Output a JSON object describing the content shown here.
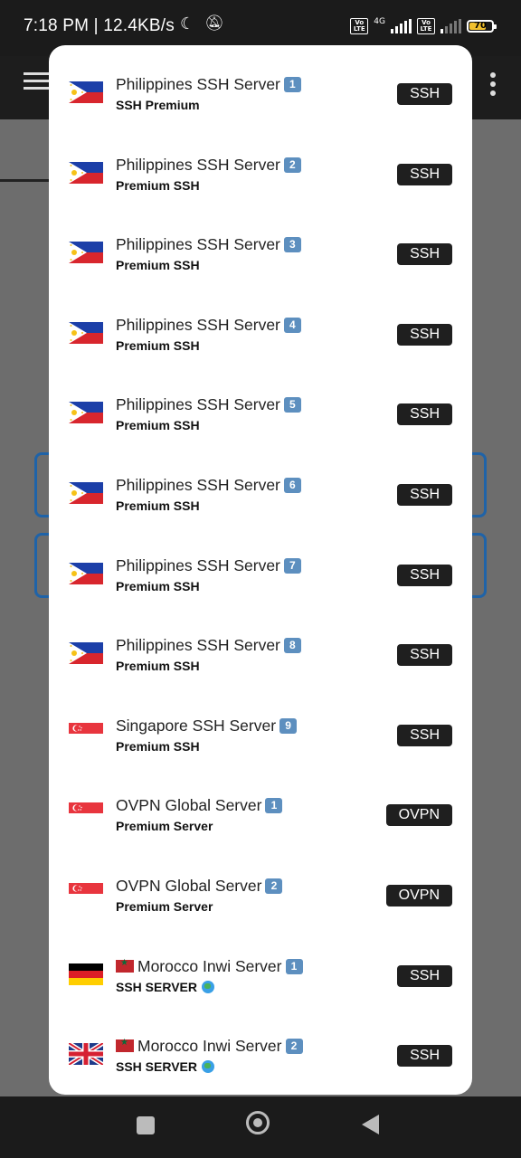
{
  "status_bar": {
    "time_speed": "7:18 PM | 12.4KB/s",
    "network": "4G",
    "volte": "Vo LTE",
    "battery": "70"
  },
  "servers": [
    {
      "title": "Philippines SSH Server",
      "number": "1",
      "subtitle": "SSH Premium",
      "badge": "SSH",
      "flag": "philippines-flag-icon"
    },
    {
      "title": "Philippines SSH Server",
      "number": "2",
      "subtitle": "Premium SSH",
      "badge": "SSH",
      "flag": "philippines-flag-icon"
    },
    {
      "title": "Philippines SSH Server",
      "number": "3",
      "subtitle": "Premium SSH",
      "badge": "SSH",
      "flag": "philippines-flag-icon"
    },
    {
      "title": "Philippines SSH Server",
      "number": "4",
      "subtitle": "Premium SSH",
      "badge": "SSH",
      "flag": "philippines-flag-icon"
    },
    {
      "title": "Philippines SSH Server",
      "number": "5",
      "subtitle": "Premium SSH",
      "badge": "SSH",
      "flag": "philippines-flag-icon"
    },
    {
      "title": "Philippines SSH Server",
      "number": "6",
      "subtitle": "Premium SSH",
      "badge": "SSH",
      "flag": "philippines-flag-icon"
    },
    {
      "title": "Philippines SSH Server",
      "number": "7",
      "subtitle": "Premium SSH",
      "badge": "SSH",
      "flag": "philippines-flag-icon"
    },
    {
      "title": "Philippines SSH Server",
      "number": "8",
      "subtitle": "Premium SSH",
      "badge": "SSH",
      "flag": "philippines-flag-icon"
    },
    {
      "title": "Singapore SSH Server",
      "number": "9",
      "subtitle": "Premium SSH",
      "badge": "SSH",
      "flag": "singapore-flag-icon"
    },
    {
      "title": "OVPN Global Server",
      "number": "1",
      "subtitle": "Premium Server",
      "badge": "OVPN",
      "flag": "singapore-flag-icon"
    },
    {
      "title": "OVPN Global Server",
      "number": "2",
      "subtitle": "Premium Server",
      "badge": "OVPN",
      "flag": "singapore-flag-icon"
    },
    {
      "title": "Morocco Inwi Server",
      "number": "1",
      "subtitle": "SSH SERVER",
      "badge": "SSH",
      "flag": "germany-flag-icon",
      "prefix_flag": "morocco-flag-icon",
      "suffix_icon": "globe-icon"
    },
    {
      "title": "Morocco Inwi Server",
      "number": "2",
      "subtitle": "SSH SERVER",
      "badge": "SSH",
      "flag": "uk-flag-icon",
      "prefix_flag": "morocco-flag-icon",
      "suffix_icon": "globe-icon"
    }
  ],
  "colors": {
    "badge_bg": "#1f1f1f",
    "keycap_blue": "#5d8fbf",
    "overlay_dim": "#6e6e6e"
  }
}
